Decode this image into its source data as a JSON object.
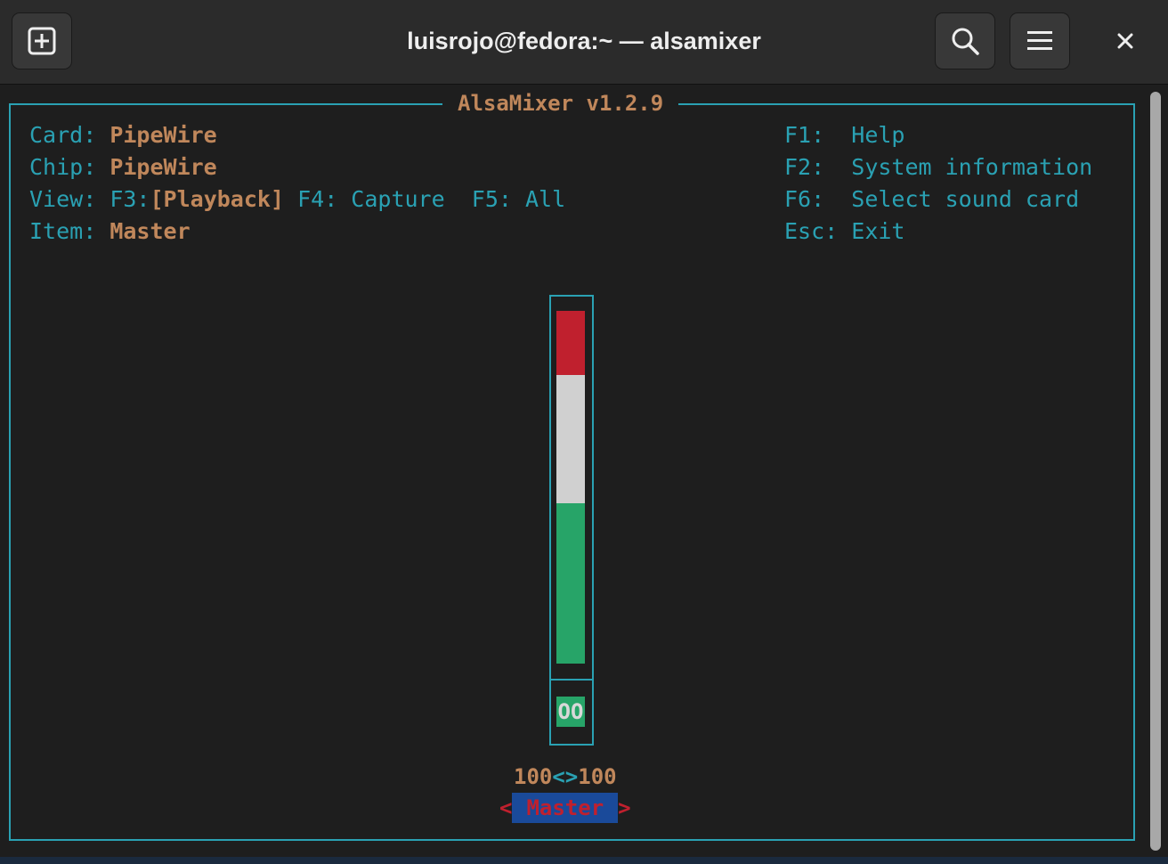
{
  "window": {
    "title": "luisrojo@fedora:~ — alsamixer",
    "buttons": {
      "new_tab_icon": "plus-square-icon",
      "search_icon": "search-icon",
      "menu_icon": "hamburger-icon",
      "close_icon": "close-icon"
    }
  },
  "mixer": {
    "app_title": "AlsaMixer v1.2.9",
    "card_label": "Card:",
    "card_value": "PipeWire",
    "chip_label": "Chip:",
    "chip_value": "PipeWire",
    "view_label": "View:",
    "view_f3": "F3:",
    "view_f3_bracket_open": "[",
    "view_playback": "Playback",
    "view_f3_bracket_close": "]",
    "view_f4": "F4: Capture",
    "view_f5": "F5: All",
    "item_label": "Item:",
    "item_value": "Master",
    "keys": [
      {
        "key": "F1:",
        "action": "Help"
      },
      {
        "key": "F2:",
        "action": "System information"
      },
      {
        "key": "F6:",
        "action": "Select sound card"
      },
      {
        "key": "Esc:",
        "action": "Exit"
      }
    ],
    "control": {
      "name": "Master",
      "left_level": "100",
      "separator": "<>",
      "right_level": "100",
      "mute_state": "OO",
      "level_fraction": 1.0,
      "arrow_left": "<",
      "arrow_right": ">"
    }
  },
  "colors": {
    "accent": "#2aa1b3",
    "value": "#c0875b",
    "bar_red": "#c0202e",
    "bar_white": "#d0d0d0",
    "bar_green": "#27a468",
    "selection": "#1a4a9a"
  }
}
